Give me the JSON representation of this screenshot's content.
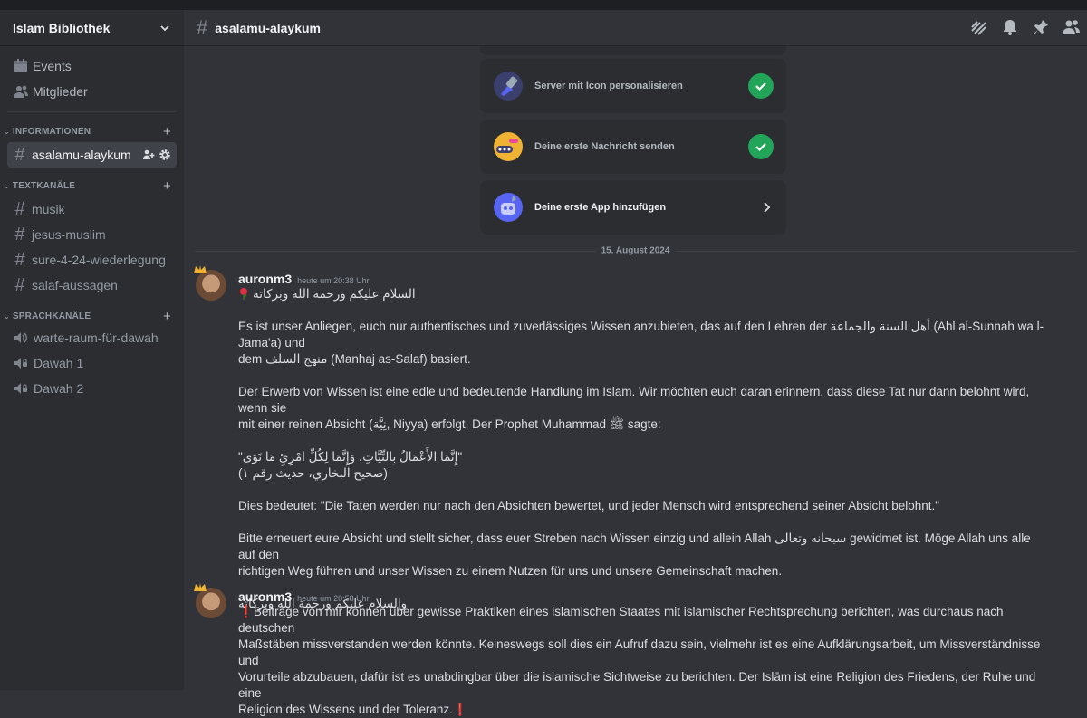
{
  "server": {
    "name": "Islam Bibliothek"
  },
  "sidebar": {
    "links": [
      {
        "label": "Events",
        "icon": "calendar-icon"
      },
      {
        "label": "Mitglieder",
        "icon": "members-icon"
      }
    ],
    "categories": [
      {
        "label": "INFORMATIONEN",
        "channels": [
          {
            "label": "asalamu-alaykum",
            "active": true
          }
        ]
      },
      {
        "label": "TEXTKANÄLE",
        "channels": [
          {
            "label": "musik"
          },
          {
            "label": "jesus-muslim"
          },
          {
            "label": "sure-4-24-wiederlegung"
          },
          {
            "label": "salaf-aussagen"
          }
        ]
      },
      {
        "label": "SPRACHKANÄLE",
        "channels": [
          {
            "label": "warte-raum-für-dawah"
          },
          {
            "label": "Dawah 1"
          },
          {
            "label": "Dawah 2"
          }
        ]
      }
    ]
  },
  "channel": {
    "title": "asalamu-alaykum"
  },
  "onboarding": [
    {
      "label": "Server mit Icon personalisieren",
      "done": true
    },
    {
      "label": "Deine erste Nachricht senden",
      "done": true
    },
    {
      "label": "Deine erste App hinzufügen",
      "done": false
    }
  ],
  "date_divider": "15. August 2024",
  "messages": [
    {
      "author": "auronm3",
      "time": "heute um 20:38 Uhr",
      "lines": [
        "السلام عليكم ورحمة الله وبركاته",
        "",
        "Es ist unser Anliegen, euch nur authentisches und zuverlässiges Wissen anzubieten, das auf den Lehren der أهل السنة والجماعة (Ahl al-Sunnah wa l-Jama'a) und",
        "dem منهج السلف (Manhaj as-Salaf) basiert.",
        "",
        "Der Erwerb von Wissen ist eine edle und bedeutende Handlung im Islam. Wir möchten euch daran erinnern, dass diese Tat nur dann belohnt wird, wenn sie",
        "mit einer reinen Absicht (نِيَّة, Niyya) erfolgt. Der Prophet Muhammad ﷺ sagte:",
        "",
        "\"إِنَّمَا الأَعْمَالُ بِالنِّيَّاتِ، وَإِنَّمَا لِكُلِّ امْرِئٍ مَا نَوَى\"",
        "(صحيح البخاري، حديث رقم ١)",
        "",
        "Dies bedeutet: \"Die Taten werden nur nach den Absichten bewertet, und jeder Mensch wird entsprechend seiner Absicht belohnt.\"",
        "",
        "Bitte erneuert eure Absicht und stellt sicher, dass euer Streben nach Wissen einzig und allein Allah سبحانه وتعالى gewidmet ist. Möge Allah uns alle auf den",
        "richtigen Weg führen und unser Wissen zu einem Nutzen für uns und unsere Gemeinschaft machen.",
        "",
        "والسلام عليكم ورحمة الله وبركاته"
      ]
    },
    {
      "author": "auronm3",
      "time": "heute um 20:58 Uhr",
      "lines": [
        "Beiträge von mir können über gewisse Praktiken eines islamischen Staates mit islamischer Rechtsprechung berichten, was durchaus nach deutschen",
        "Maßstäben missverstanden werden könnte. Keineswegs soll dies ein Aufruf dazu sein, vielmehr ist es eine Aufklärungsarbeit, um Missverständnisse und",
        "Vorurteile abzubauen, dafür ist es unabdingbar über die islamische Sichtweise zu berichten. Der Islām ist eine Religion des Friedens, der Ruhe und eine",
        "Religion des Wissens und der Toleranz."
      ]
    }
  ]
}
